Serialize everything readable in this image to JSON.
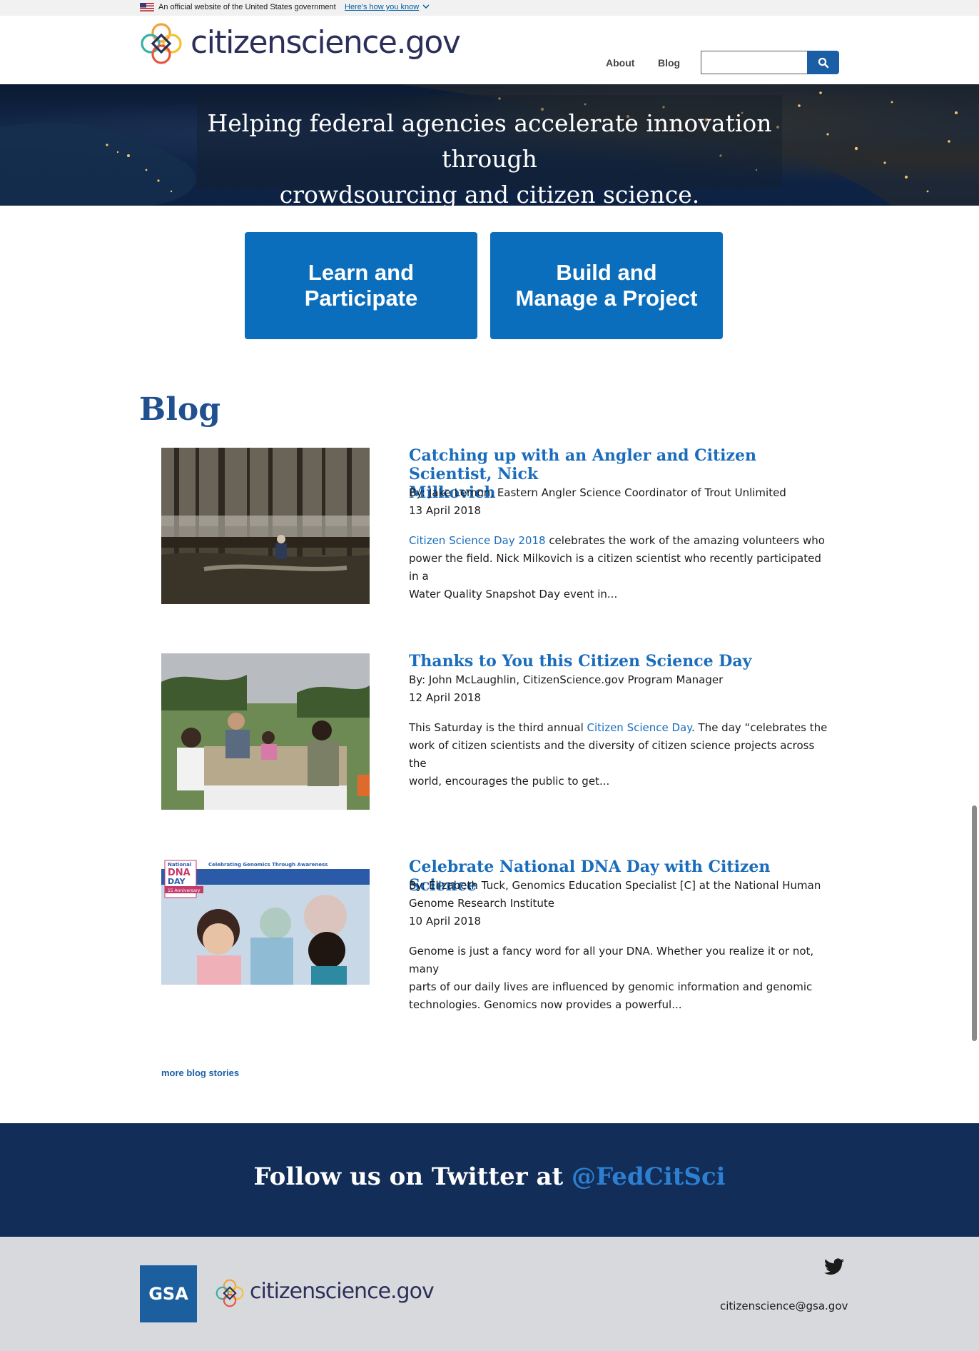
{
  "banner": {
    "official_text": "An official website of the United States government",
    "how_you_know": "Here's how you know"
  },
  "header": {
    "logo_text": "citizenscience.gov",
    "nav": {
      "about": "About",
      "blog": "Blog"
    },
    "search": {
      "value": "",
      "placeholder": ""
    }
  },
  "hero": {
    "line1": "Helping federal agencies accelerate innovation through",
    "line2": "crowdsourcing and citizen science."
  },
  "cta": {
    "learn_line1": "Learn and",
    "learn_line2": "Participate",
    "build_line1": "Build and",
    "build_line2": "Manage a Project"
  },
  "blog": {
    "heading": "Blog",
    "posts": [
      {
        "title_line1": "Catching up with an Angler and Citizen Scientist, Nick",
        "title_line2": "Milkovich",
        "byline": "By: Jake Lemon, Eastern Angler Science Coordinator of Trout Unlimited",
        "date": "13 April 2018",
        "excerpt_link": "Citizen Science Day 2018",
        "excerpt_l1_rest": " celebrates the work of the amazing volunteers who",
        "excerpt_l2": "power the field. Nick Milkovich is a citizen scientist who recently participated in a",
        "excerpt_l3": "Water Quality Snapshot Day event in..."
      },
      {
        "title_line1": "Thanks to You this Citizen Science Day",
        "byline": "By: John McLaughlin, CitizenScience.gov Program Manager",
        "date": "12 April 2018",
        "excerpt_l1_pre": "This Saturday is the third annual ",
        "excerpt_link": "Citizen Science Day",
        "excerpt_l1_post": ". The day “celebrates the",
        "excerpt_l2": "work of citizen scientists and the diversity of citizen science projects across the",
        "excerpt_l3": "world, encourages the public to get..."
      },
      {
        "title_line1": "Celebrate National DNA Day with Citizen Science",
        "byline_l1": "By: Elizabeth Tuck, Genomics Education Specialist [C] at the National Human",
        "byline_l2": "Genome Research Institute",
        "date": "10 April 2018",
        "excerpt_l1": "Genome is just a fancy word for all your DNA. Whether you realize it or not, many",
        "excerpt_l2": "parts of our daily lives are influenced by genomic information and genomic",
        "excerpt_l3": "technologies. Genomics now provides a powerful...",
        "image_banner": "Celebrating Genomics Through Awareness",
        "image_badge_l1": "National",
        "image_badge_l2": "DNA",
        "image_badge_l3": "DAY",
        "image_badge_ribbon": "15 Anniversary"
      }
    ],
    "more_link": "more blog stories"
  },
  "twitter": {
    "prefix": "Follow us on Twitter at ",
    "handle": "@FedCitSci"
  },
  "footer": {
    "gsa": "GSA",
    "logo_text": "citizenscience.gov",
    "email": "citizenscience@gsa.gov"
  },
  "colors": {
    "primary_blue": "#0a6ebd",
    "heading_blue": "#20508f",
    "link_blue": "#1a6cbc",
    "twitter_band": "#122d58",
    "footer_gray": "#d8d9dc"
  }
}
